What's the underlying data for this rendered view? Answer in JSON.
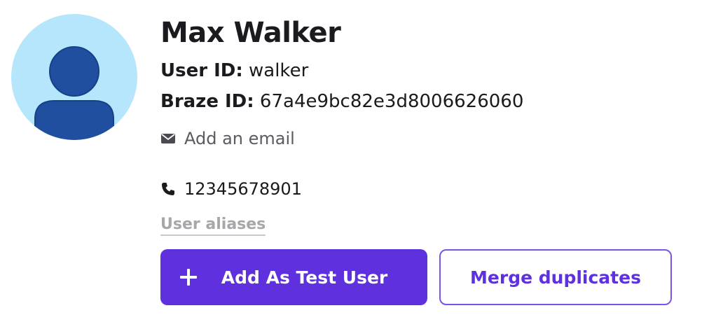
{
  "profile": {
    "name": "Max Walker",
    "user_id_label": "User ID:",
    "user_id_value": "walker",
    "braze_id_label": "Braze ID:",
    "braze_id_value": "67a4e9bc82e3d8006626060",
    "email_text": "Add an email",
    "phone_text": "12345678901",
    "aliases_label": "User aliases"
  },
  "actions": {
    "add_test_user_label": "Add As Test User",
    "merge_label": "Merge duplicates"
  },
  "icons": {
    "avatar": "user-avatar-icon",
    "email": "envelope-icon",
    "phone": "phone-icon",
    "add": "plus-icon"
  },
  "colors": {
    "accent": "#5e30de",
    "avatar_bg": "#b6e6fb",
    "avatar_fg": "#1f4f9e",
    "muted": "#5a5a61",
    "alias": "#a6a6ab"
  }
}
